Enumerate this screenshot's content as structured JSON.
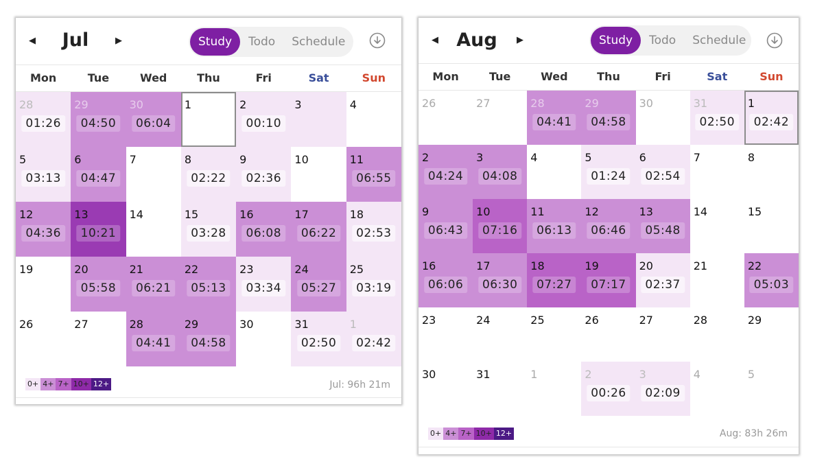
{
  "july": {
    "month": "Jul",
    "tabs": [
      "Study",
      "Todo",
      "Schedule"
    ],
    "weekdays": [
      "Mon",
      "Tue",
      "Wed",
      "Thu",
      "Fri",
      "Sat",
      "Sun"
    ],
    "total": "Jul: 96h 21m",
    "legend": [
      "0+",
      "4+",
      "7+",
      "10+",
      "12+"
    ],
    "cells": [
      {
        "d": "28",
        "t": "01:26",
        "lvl": 1,
        "other": true
      },
      {
        "d": "29",
        "t": "04:50",
        "lvl": 2,
        "other": true
      },
      {
        "d": "30",
        "t": "06:04",
        "lvl": 2,
        "other": true
      },
      {
        "d": "1",
        "t": "",
        "lvl": 0,
        "today": true
      },
      {
        "d": "2",
        "t": "00:10",
        "lvl": 1
      },
      {
        "d": "3",
        "t": "",
        "lvl": 1
      },
      {
        "d": "4",
        "t": "",
        "lvl": 0
      },
      {
        "d": "5",
        "t": "03:13",
        "lvl": 1
      },
      {
        "d": "6",
        "t": "04:47",
        "lvl": 2
      },
      {
        "d": "7",
        "t": "",
        "lvl": 0
      },
      {
        "d": "8",
        "t": "02:22",
        "lvl": 1
      },
      {
        "d": "9",
        "t": "02:36",
        "lvl": 1
      },
      {
        "d": "10",
        "t": "",
        "lvl": 0
      },
      {
        "d": "11",
        "t": "06:55",
        "lvl": 2
      },
      {
        "d": "12",
        "t": "04:36",
        "lvl": 2
      },
      {
        "d": "13",
        "t": "10:21",
        "lvl": 4
      },
      {
        "d": "14",
        "t": "",
        "lvl": 0
      },
      {
        "d": "15",
        "t": "03:28",
        "lvl": 1
      },
      {
        "d": "16",
        "t": "06:08",
        "lvl": 2
      },
      {
        "d": "17",
        "t": "06:22",
        "lvl": 2
      },
      {
        "d": "18",
        "t": "02:53",
        "lvl": 1
      },
      {
        "d": "19",
        "t": "",
        "lvl": 0
      },
      {
        "d": "20",
        "t": "05:58",
        "lvl": 2
      },
      {
        "d": "21",
        "t": "06:21",
        "lvl": 2
      },
      {
        "d": "22",
        "t": "05:13",
        "lvl": 2
      },
      {
        "d": "23",
        "t": "03:34",
        "lvl": 1
      },
      {
        "d": "24",
        "t": "05:27",
        "lvl": 2
      },
      {
        "d": "25",
        "t": "03:19",
        "lvl": 1
      },
      {
        "d": "26",
        "t": "",
        "lvl": 0
      },
      {
        "d": "27",
        "t": "",
        "lvl": 0
      },
      {
        "d": "28",
        "t": "04:41",
        "lvl": 2
      },
      {
        "d": "29",
        "t": "04:58",
        "lvl": 2
      },
      {
        "d": "30",
        "t": "",
        "lvl": 0
      },
      {
        "d": "31",
        "t": "02:50",
        "lvl": 1
      },
      {
        "d": "1",
        "t": "02:42",
        "lvl": 1,
        "other": true
      }
    ]
  },
  "august": {
    "month": "Aug",
    "tabs": [
      "Study",
      "Todo",
      "Schedule"
    ],
    "weekdays": [
      "Mon",
      "Tue",
      "Wed",
      "Thu",
      "Fri",
      "Sat",
      "Sun"
    ],
    "total": "Aug: 83h 26m",
    "legend": [
      "0+",
      "4+",
      "7+",
      "10+",
      "12+"
    ],
    "cells": [
      {
        "d": "26",
        "t": "",
        "lvl": 0,
        "other": true
      },
      {
        "d": "27",
        "t": "",
        "lvl": 0,
        "other": true
      },
      {
        "d": "28",
        "t": "04:41",
        "lvl": 2,
        "other": true
      },
      {
        "d": "29",
        "t": "04:58",
        "lvl": 2,
        "other": true
      },
      {
        "d": "30",
        "t": "",
        "lvl": 0,
        "other": true
      },
      {
        "d": "31",
        "t": "02:50",
        "lvl": 1,
        "other": true
      },
      {
        "d": "1",
        "t": "02:42",
        "lvl": 1,
        "today": true
      },
      {
        "d": "2",
        "t": "04:24",
        "lvl": 2
      },
      {
        "d": "3",
        "t": "04:08",
        "lvl": 2
      },
      {
        "d": "4",
        "t": "",
        "lvl": 0
      },
      {
        "d": "5",
        "t": "01:24",
        "lvl": 1
      },
      {
        "d": "6",
        "t": "02:54",
        "lvl": 1
      },
      {
        "d": "7",
        "t": "",
        "lvl": 0
      },
      {
        "d": "8",
        "t": "",
        "lvl": 0
      },
      {
        "d": "9",
        "t": "06:43",
        "lvl": 2
      },
      {
        "d": "10",
        "t": "07:16",
        "lvl": 3
      },
      {
        "d": "11",
        "t": "06:13",
        "lvl": 2
      },
      {
        "d": "12",
        "t": "06:46",
        "lvl": 2
      },
      {
        "d": "13",
        "t": "05:48",
        "lvl": 2
      },
      {
        "d": "14",
        "t": "",
        "lvl": 0
      },
      {
        "d": "15",
        "t": "",
        "lvl": 0
      },
      {
        "d": "16",
        "t": "06:06",
        "lvl": 2
      },
      {
        "d": "17",
        "t": "06:30",
        "lvl": 2
      },
      {
        "d": "18",
        "t": "07:27",
        "lvl": 3
      },
      {
        "d": "19",
        "t": "07:17",
        "lvl": 3
      },
      {
        "d": "20",
        "t": "02:37",
        "lvl": 1
      },
      {
        "d": "21",
        "t": "",
        "lvl": 0
      },
      {
        "d": "22",
        "t": "05:03",
        "lvl": 2
      },
      {
        "d": "23",
        "t": "",
        "lvl": 0
      },
      {
        "d": "24",
        "t": "",
        "lvl": 0
      },
      {
        "d": "25",
        "t": "",
        "lvl": 0
      },
      {
        "d": "26",
        "t": "",
        "lvl": 0
      },
      {
        "d": "27",
        "t": "",
        "lvl": 0
      },
      {
        "d": "28",
        "t": "",
        "lvl": 0
      },
      {
        "d": "29",
        "t": "",
        "lvl": 0
      },
      {
        "d": "30",
        "t": "",
        "lvl": 0
      },
      {
        "d": "31",
        "t": "",
        "lvl": 0
      },
      {
        "d": "1",
        "t": "",
        "lvl": 0,
        "other": true
      },
      {
        "d": "2",
        "t": "00:26",
        "lvl": 1,
        "other": true
      },
      {
        "d": "3",
        "t": "02:09",
        "lvl": 1,
        "other": true
      },
      {
        "d": "4",
        "t": "",
        "lvl": 0,
        "other": true
      },
      {
        "d": "5",
        "t": "",
        "lvl": 0,
        "other": true
      }
    ]
  }
}
